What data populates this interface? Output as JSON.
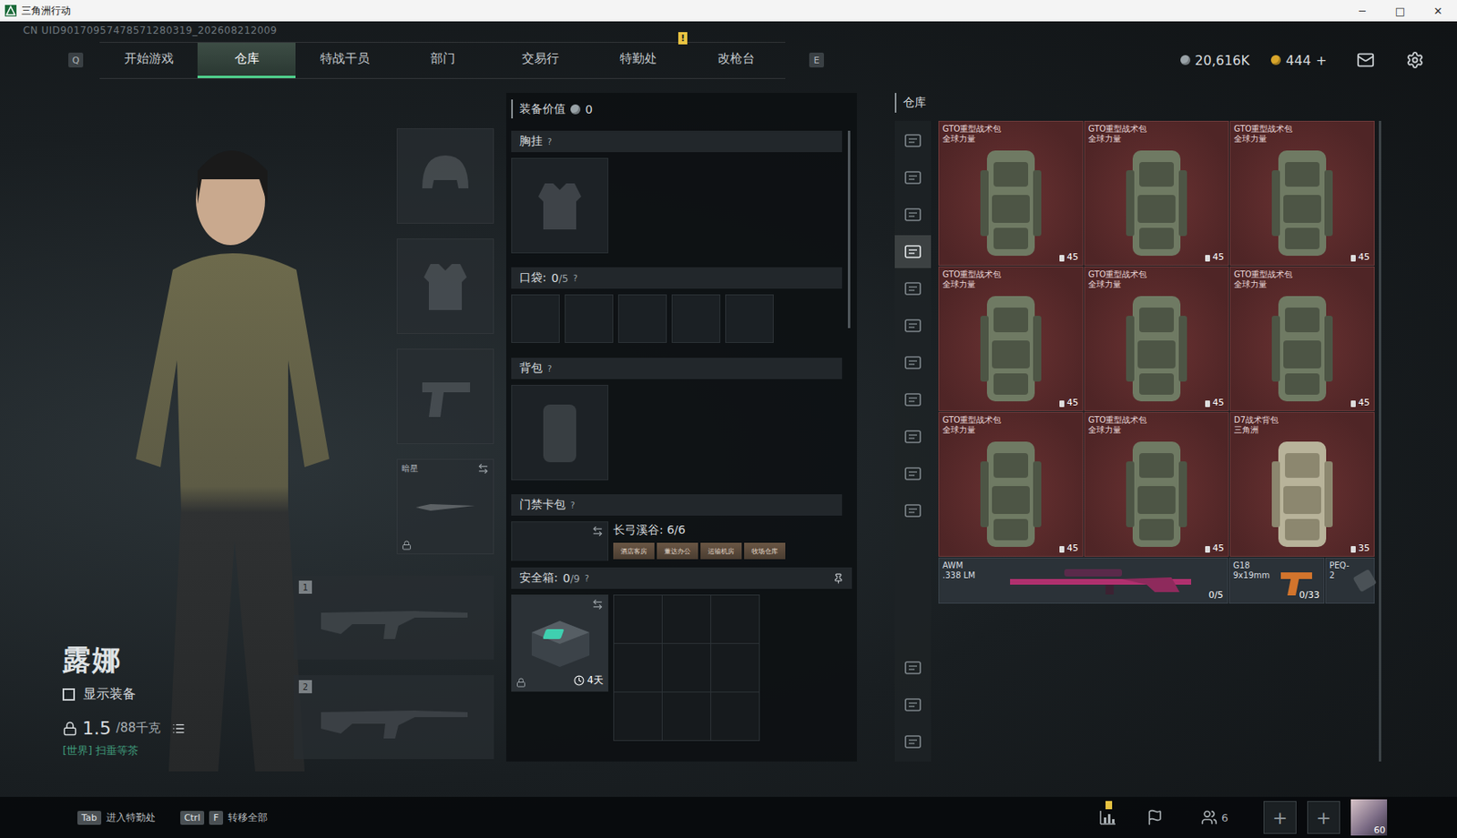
{
  "window": {
    "title": "三角洲行动",
    "controls": [
      "─",
      "□",
      "✕"
    ]
  },
  "uid": "CN UID90170957478571280319_202608212009",
  "nav": {
    "prev_key": "Q",
    "next_key": "E",
    "alert_mark": "!",
    "tabs": [
      {
        "label": "开始游戏",
        "selected": false,
        "alert": false
      },
      {
        "label": "仓库",
        "selected": true,
        "alert": false
      },
      {
        "label": "特战干员",
        "selected": false,
        "alert": false
      },
      {
        "label": "部门",
        "selected": false,
        "alert": false
      },
      {
        "label": "交易行",
        "selected": false,
        "alert": false
      },
      {
        "label": "特勤处",
        "selected": false,
        "alert": true
      },
      {
        "label": "改枪台",
        "selected": false,
        "alert": false
      }
    ],
    "currencies": [
      {
        "value": "20,616K",
        "add": "",
        "color": "#9aa3a8"
      },
      {
        "value": "444",
        "add": "+",
        "color": "#d9a62b"
      }
    ]
  },
  "character": {
    "name": "露娜",
    "show_equipment": {
      "label": "显示装备",
      "checked": false
    },
    "weight": "1.5",
    "weight_limit": "/88千克",
    "chat": "[世界] 扫垂等茶"
  },
  "gear_slots": [
    {
      "kind": "helmet",
      "label": "",
      "locked": false
    },
    {
      "kind": "armor",
      "label": "",
      "locked": false
    },
    {
      "kind": "pistol",
      "label": "",
      "locked": false
    },
    {
      "kind": "melee",
      "label": "暗星",
      "locked": true
    }
  ],
  "weapon_slots": [
    {
      "number": "1"
    },
    {
      "number": "2"
    }
  ],
  "loadout": {
    "value_label": "装备价值",
    "value": "0",
    "help": "?",
    "chest_rig": {
      "title": "胸挂"
    },
    "pockets": {
      "title": "口袋:",
      "used": "0",
      "capacity": "/5",
      "cells": 5
    },
    "backpack": {
      "title": "背包"
    },
    "keycard": {
      "title": "门禁卡包",
      "map": "长弓溪谷: 6/6",
      "cards": [
        "酒店客房",
        "董达办公",
        "运输机房",
        "牧场仓库"
      ]
    },
    "safe_box": {
      "title": "安全箱:",
      "used": "0",
      "capacity": "/9",
      "timer": "4天",
      "locked": true,
      "cells": 9
    }
  },
  "warehouse": {
    "title": "仓库",
    "sidebar_top": [
      {
        "selected": false
      },
      {
        "selected": false
      },
      {
        "selected": false
      },
      {
        "selected": true
      },
      {
        "selected": false
      },
      {
        "selected": false
      },
      {
        "selected": false
      },
      {
        "selected": false
      },
      {
        "selected": false
      },
      {
        "selected": false
      },
      {
        "selected": false
      }
    ],
    "sidebar_bottom": [
      {
        "selected": false
      },
      {
        "selected": false
      },
      {
        "selected": false
      }
    ],
    "items": [
      {
        "name": "GTO重型战术包",
        "faction": "全球力量",
        "count": "45",
        "kind": "heavy"
      },
      {
        "name": "GTO重型战术包",
        "faction": "全球力量",
        "count": "45",
        "kind": "heavy"
      },
      {
        "name": "GTO重型战术包",
        "faction": "全球力量",
        "count": "45",
        "kind": "heavy"
      },
      {
        "name": "GTO重型战术包",
        "faction": "全球力量",
        "count": "45",
        "kind": "heavy"
      },
      {
        "name": "GTO重型战术包",
        "faction": "全球力量",
        "count": "45",
        "kind": "heavy"
      },
      {
        "name": "GTO重型战术包",
        "faction": "全球力量",
        "count": "45",
        "kind": "heavy"
      },
      {
        "name": "GTO重型战术包",
        "faction": "全球力量",
        "count": "45",
        "kind": "heavy"
      },
      {
        "name": "GTO重型战术包",
        "faction": "全球力量",
        "count": "45",
        "kind": "heavy"
      },
      {
        "name": "D7战术背包",
        "faction": "三角洲",
        "count": "35",
        "kind": "light"
      }
    ],
    "weapons": [
      {
        "name": "AWM",
        "caliber": ".338 LM",
        "ammo": "0/5",
        "kind": "rifle"
      },
      {
        "name": "G18",
        "caliber": "9x19mm",
        "ammo": "0/33",
        "kind": "pistol"
      },
      {
        "name": "PEQ-2",
        "caliber": "",
        "ammo": "",
        "kind": "attachment"
      }
    ]
  },
  "footer": {
    "hints": [
      {
        "keys": [
          "Tab"
        ],
        "label": "进入特勤处"
      },
      {
        "keys": [
          "Ctrl",
          "F"
        ],
        "label": "转移全部"
      }
    ],
    "squad_count": "6",
    "add_slots": [
      "+",
      "+"
    ],
    "level": "60"
  }
}
